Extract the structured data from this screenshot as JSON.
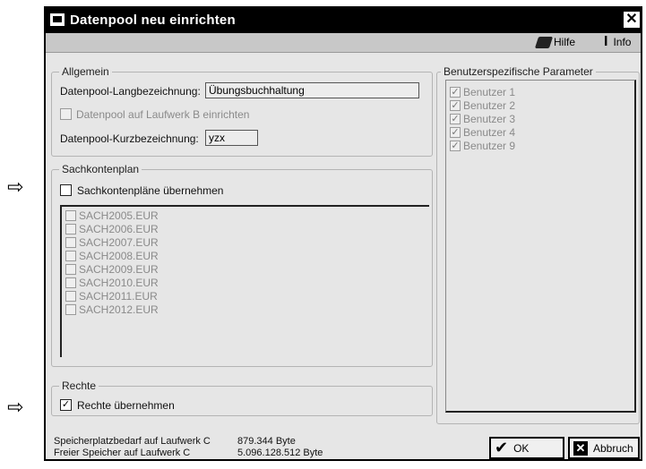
{
  "annotations": {
    "arrow_glyph": "⇨"
  },
  "window": {
    "title": "Datenpool neu einrichten",
    "close_glyph": "✕"
  },
  "toolbar": {
    "help_label": "Hilfe",
    "info_label": "Info",
    "info_glyph": "I"
  },
  "general": {
    "legend": "Allgemein",
    "long_name_label": "Datenpool-Langbezeichnung:",
    "long_name_value": "Übungsbuchhaltung",
    "drive_b_label": "Datenpool auf Laufwerk B einrichten",
    "short_name_label": "Datenpool-Kurzbezeichnung:",
    "short_name_value": "yzx"
  },
  "accounts": {
    "legend": "Sachkontenplan",
    "adopt_label": "Sachkontenpläne übernehmen",
    "items": [
      "SACH2005.EUR",
      "SACH2006.EUR",
      "SACH2007.EUR",
      "SACH2008.EUR",
      "SACH2009.EUR",
      "SACH2010.EUR",
      "SACH2011.EUR",
      "SACH2012.EUR"
    ]
  },
  "rights": {
    "legend": "Rechte",
    "adopt_label": "Rechte übernehmen",
    "check_glyph": "✓"
  },
  "user_params": {
    "legend": "Benutzerspezifische Parameter",
    "users": [
      "Benutzer 1",
      "Benutzer 2",
      "Benutzer 3",
      "Benutzer 4",
      "Benutzer 9"
    ]
  },
  "status": {
    "required_label": "Speicherplatzbedarf auf Laufwerk C",
    "required_value": "879.344 Byte",
    "free_label": "Freier Speicher auf Laufwerk C",
    "free_value": "5.096.128.512 Byte"
  },
  "buttons": {
    "ok_label": "OK",
    "ok_glyph": "✔",
    "cancel_label": "Abbruch",
    "cancel_glyph": "✕"
  }
}
